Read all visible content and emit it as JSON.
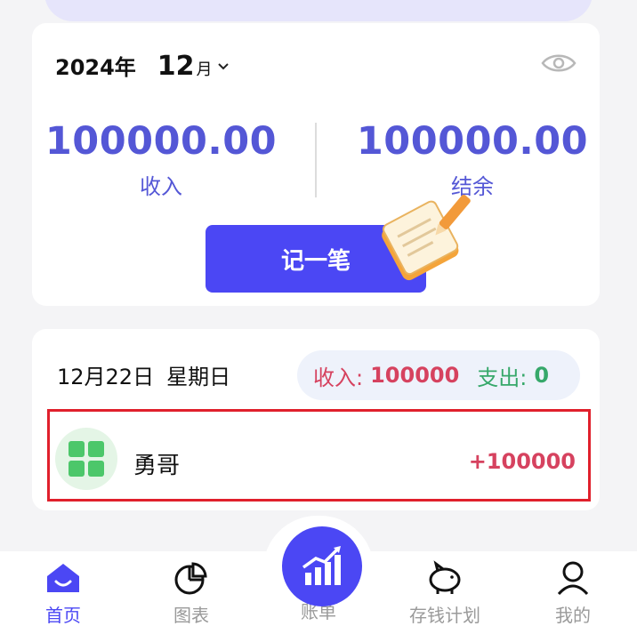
{
  "summary": {
    "year": "2024年",
    "month": "12",
    "month_suffix": "月",
    "income_value": "100000.00",
    "income_label": "收入",
    "balance_value": "100000.00",
    "balance_label": "结余",
    "record_button": "记一笔"
  },
  "day": {
    "date": "12月22日",
    "weekday": "星期日",
    "income_label": "收入:",
    "income_value": "100000",
    "expense_label": "支出:",
    "expense_value": "0"
  },
  "transactions": [
    {
      "name": "勇哥",
      "amount": "+100000",
      "icon": "grid-category-icon"
    }
  ],
  "tabbar": {
    "home": "首页",
    "charts": "图表",
    "bills": "账单",
    "savings": "存钱计划",
    "mine": "我的"
  },
  "colors": {
    "accent": "#4b47f4",
    "income": "#d6425f",
    "expense": "#36a86a",
    "stat": "#5457d6"
  }
}
